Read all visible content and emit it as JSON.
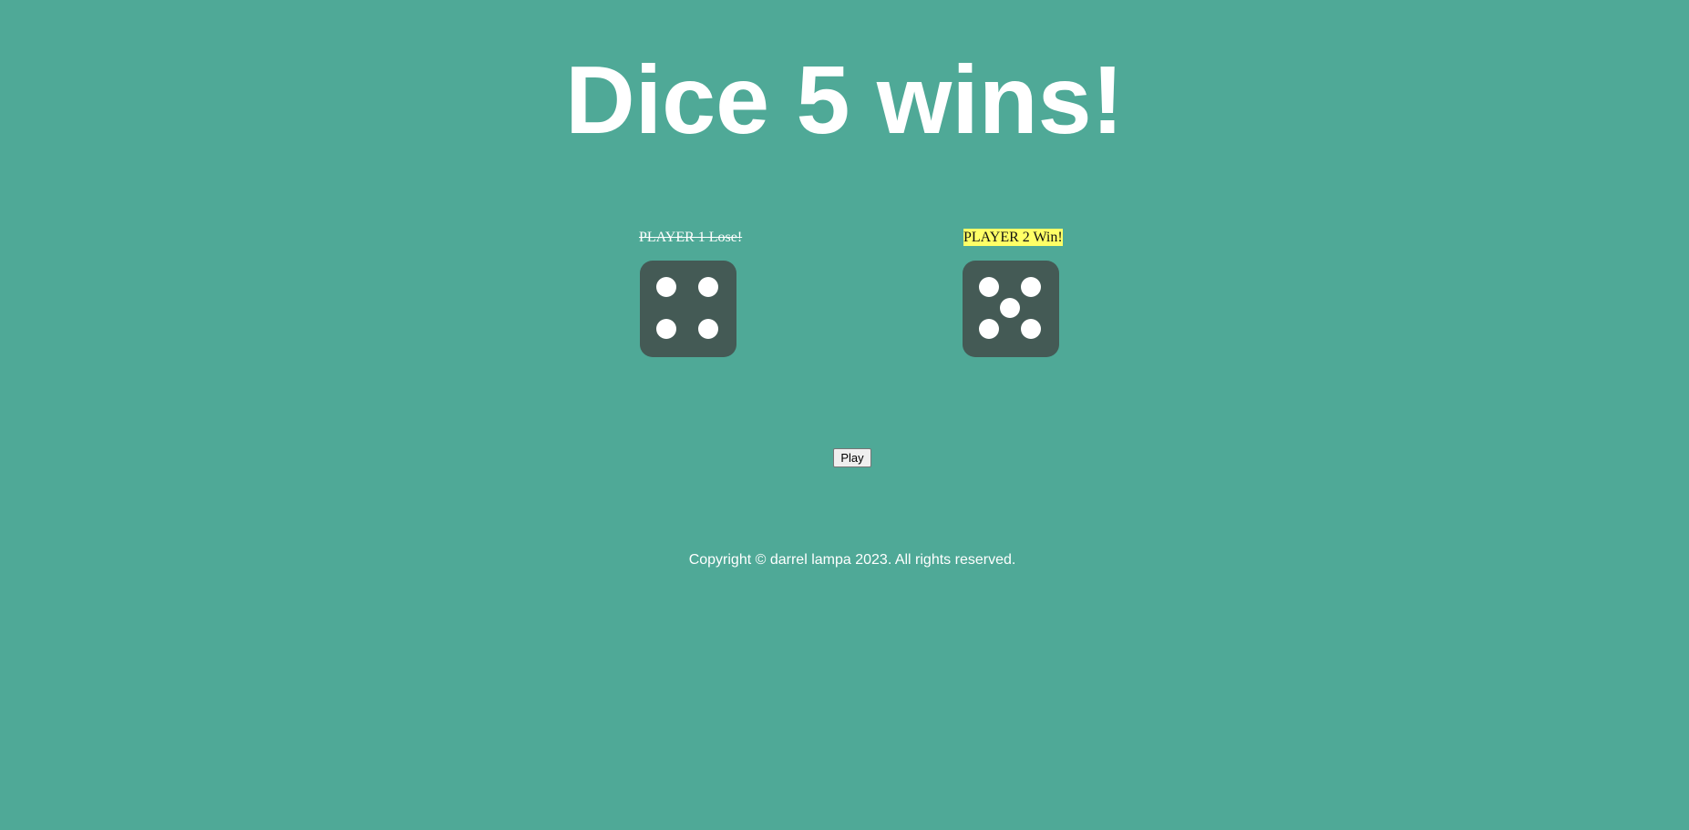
{
  "heading": "Dice 5 wins!",
  "players": [
    {
      "label": "PLAYER 1 Lose!",
      "die_value": 4,
      "status": "lose"
    },
    {
      "label": "PLAYER 2 Win!",
      "die_value": 5,
      "status": "win"
    }
  ],
  "play_button": {
    "label": "Play"
  },
  "footer": {
    "copyright": "Copyright © darrel lampa 2023. All rights reserved."
  },
  "colors": {
    "background": "#4fa997",
    "die": "#445a55",
    "pip": "#ffffff",
    "winner_highlight": "#ffff66"
  }
}
